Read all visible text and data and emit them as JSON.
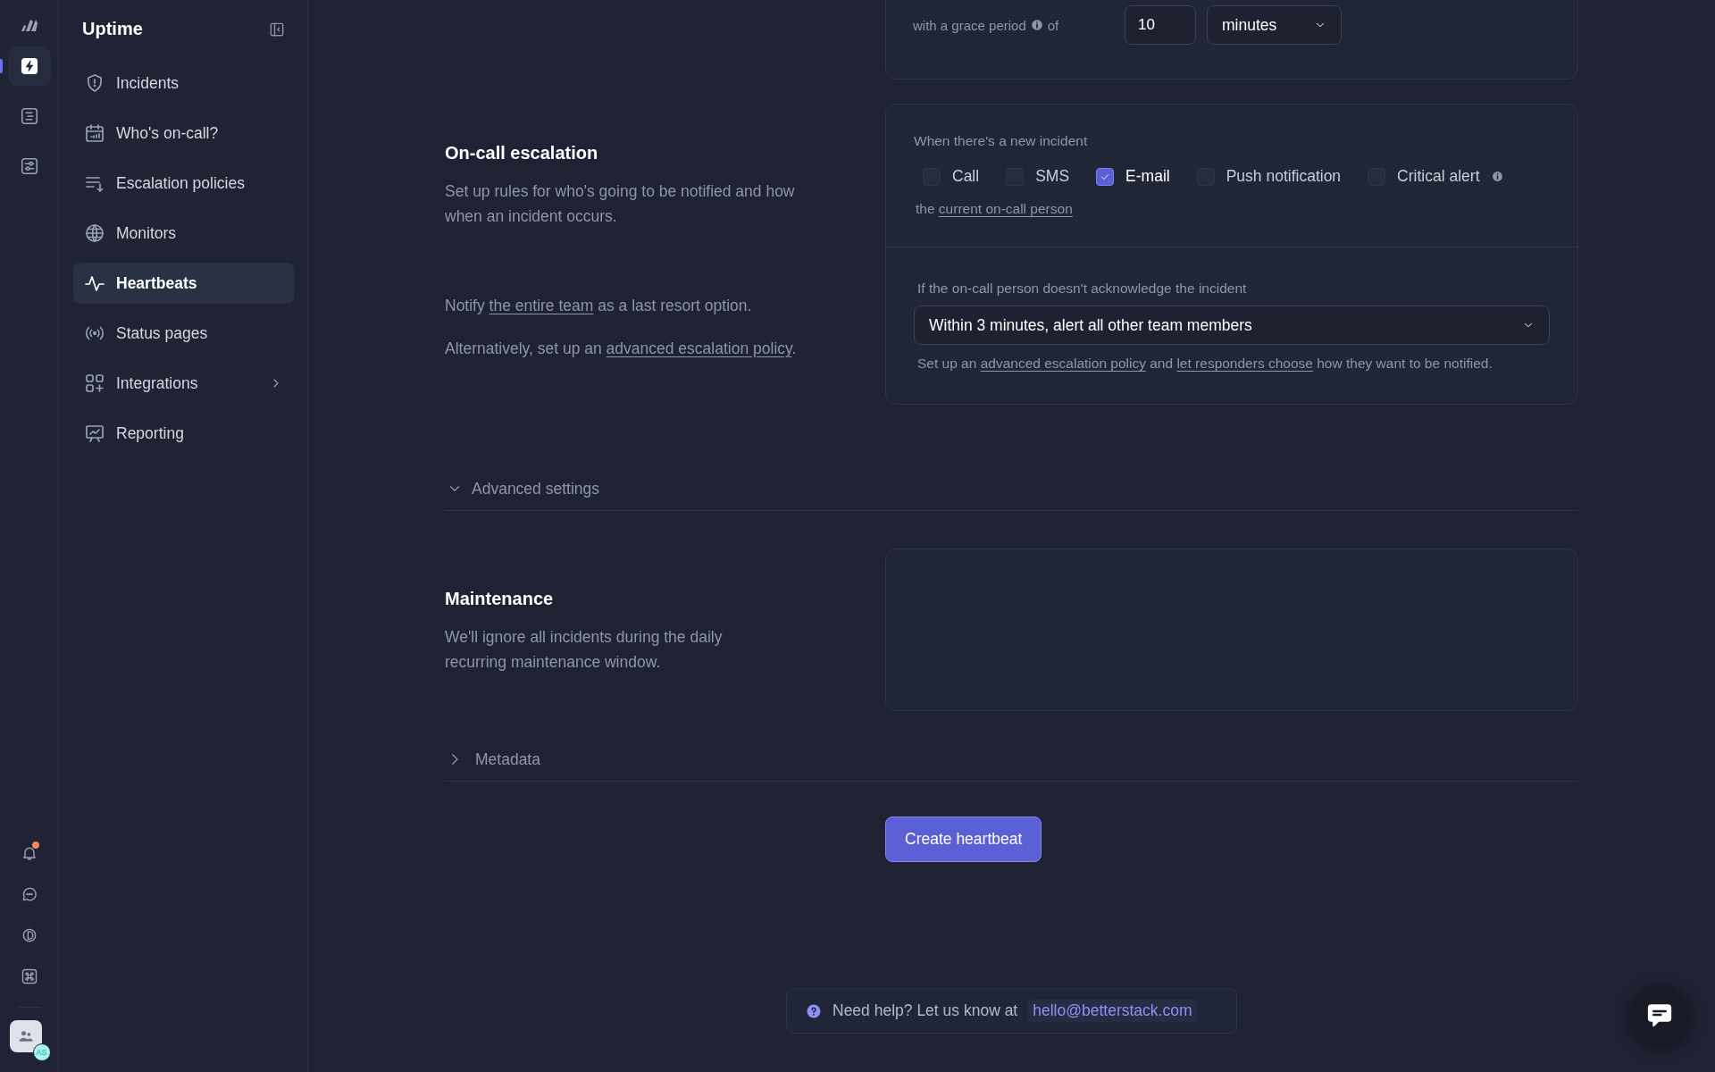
{
  "rail": {
    "items": [
      {
        "kind": "incidents",
        "selected": true
      },
      {
        "kind": "logs",
        "selected": false
      },
      {
        "kind": "dashboards",
        "selected": false
      }
    ],
    "notifications": {
      "unread": true
    },
    "user": {
      "initials": "AS"
    }
  },
  "sidebar": {
    "title": "Uptime",
    "items": [
      {
        "label": "Incidents",
        "selected": false,
        "submenu": false
      },
      {
        "label": "Who's on-call?",
        "selected": false,
        "submenu": false
      },
      {
        "label": "Escalation policies",
        "selected": false,
        "submenu": false
      },
      {
        "label": "Monitors",
        "selected": false,
        "submenu": false
      },
      {
        "label": "Heartbeats",
        "selected": true,
        "submenu": false
      },
      {
        "label": "Status pages",
        "selected": false,
        "submenu": false
      },
      {
        "label": "Integrations",
        "selected": false,
        "submenu": true
      },
      {
        "label": "Reporting",
        "selected": false,
        "submenu": false
      }
    ]
  },
  "grace_period": {
    "label": "with a grace period",
    "suffix": "of",
    "value": "10",
    "unit": "minutes"
  },
  "escalation": {
    "title": "On-call escalation",
    "description": "Set up rules for who's going to be notified and how when an incident occurs.",
    "notes": [
      [
        {
          "text": "Notify "
        },
        {
          "link": "the entire team"
        },
        {
          "text": " as a last resort option."
        }
      ],
      [
        {
          "text": "Alternatively, set up an "
        },
        {
          "link": "advanced escalation policy"
        },
        {
          "text": "."
        }
      ]
    ],
    "trigger_label": "When there's a new incident",
    "channels": [
      {
        "label": "Call",
        "checked": false,
        "info": false
      },
      {
        "label": "SMS",
        "checked": false,
        "info": false
      },
      {
        "label": "E-mail",
        "checked": true,
        "info": false
      },
      {
        "label": "Push notification",
        "checked": false,
        "info": false
      },
      {
        "label": "Critical alert",
        "checked": false,
        "info": true
      }
    ],
    "target": [
      {
        "text": "the "
      },
      {
        "link": "current on-call person"
      }
    ],
    "fallback_label": "If the on-call person doesn't acknowledge the incident",
    "fallback_value": "Within 3 minutes, alert all other team members",
    "hint": [
      {
        "text": "Set up an "
      },
      {
        "link": "advanced escalation policy"
      },
      {
        "text": " and "
      },
      {
        "link": "let responders choose"
      },
      {
        "text": " how they want to be notified."
      }
    ]
  },
  "advanced_settings": {
    "label": "Advanced settings",
    "expanded": true
  },
  "maintenance": {
    "title": "Maintenance",
    "description": "We'll ignore all incidents during the daily recurring maintenance window."
  },
  "metadata": {
    "label": "Metadata",
    "expanded": false
  },
  "submit": {
    "label": "Create heartbeat"
  },
  "help": {
    "text": "Need help? Let us know at",
    "email": "hello@betterstack.com"
  }
}
